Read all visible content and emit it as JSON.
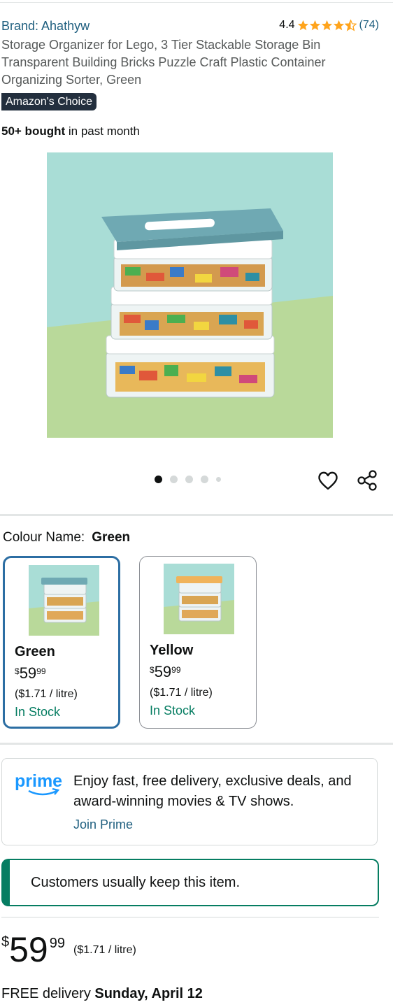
{
  "product": {
    "brand": "Brand: Ahathyw",
    "rating": "4.4",
    "rating_count": "(74)",
    "title": "Storage Organizer for Lego, 3 Tier Stackable Storage Bin Transparent Building Bricks Puzzle Craft Plastic Container Organizing Sorter, Green",
    "badge": "Amazon's Choice",
    "bought_bold": "50+ bought",
    "bought_rest": " in past month"
  },
  "gallery": {
    "image_count": 5,
    "active_index": 0
  },
  "colour": {
    "label": "Colour Name:",
    "selected": "Green",
    "options": [
      {
        "name": "Green",
        "currency": "$",
        "whole": "59",
        "fraction": "99",
        "unit_price": "($1.71 / litre)",
        "stock": "In Stock",
        "lid_color": "#6fa9b3"
      },
      {
        "name": "Yellow",
        "currency": "$",
        "whole": "59",
        "fraction": "99",
        "unit_price": "($1.71 / litre)",
        "stock": "In Stock",
        "lid_color": "#f0b35a"
      }
    ]
  },
  "prime": {
    "logo": "prime",
    "text": "Enjoy fast, free delivery, exclusive deals, and award-winning movies & TV shows.",
    "link": "Join Prime"
  },
  "keep": {
    "text": "Customers usually keep this item."
  },
  "price": {
    "currency": "$",
    "whole": "59",
    "fraction": "99",
    "unit": "($1.71 / litre)"
  },
  "delivery": {
    "prefix": "FREE delivery ",
    "date": "Sunday, April 12"
  },
  "colors": {
    "link": "#1f5f7f",
    "star": "#ffa41c",
    "stock": "#067d62",
    "selected_border": "#2c6ea3",
    "badge_bg": "#232f3e"
  }
}
